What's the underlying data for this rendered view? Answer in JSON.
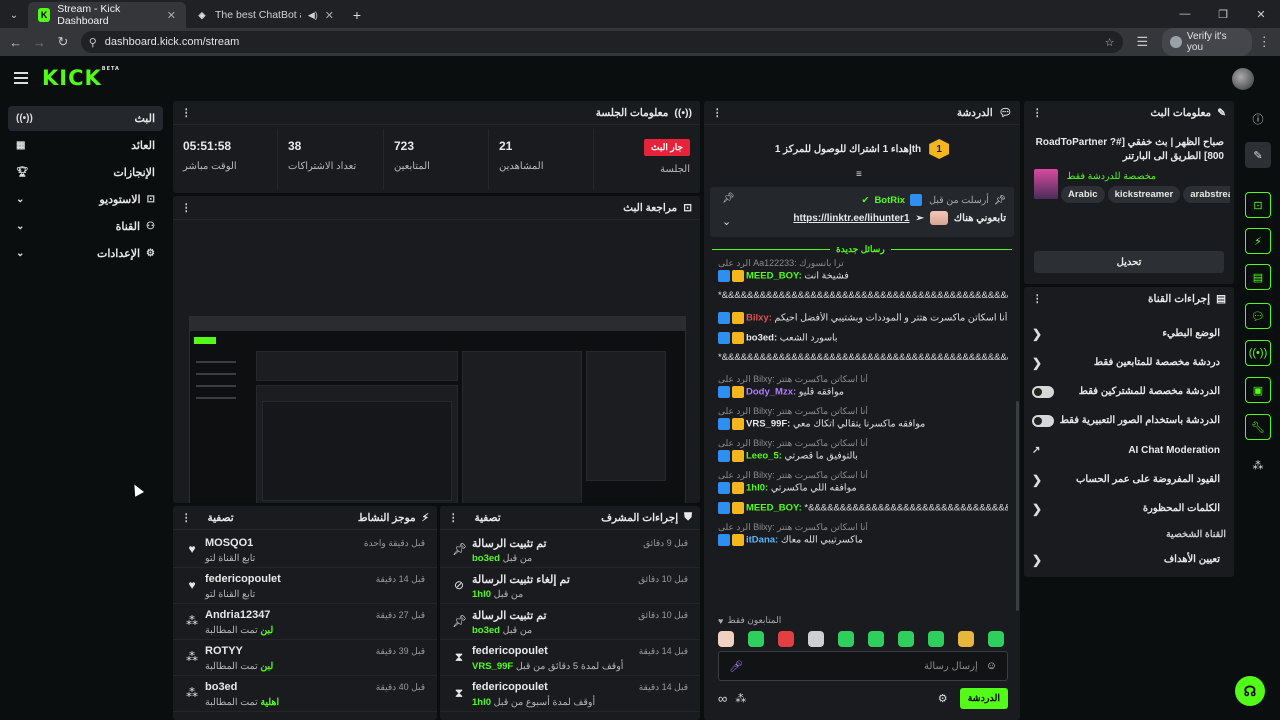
{
  "browser": {
    "tabs": [
      {
        "title": "Stream - Kick Dashboard",
        "active": true
      },
      {
        "title": "The best ChatBot and Widg",
        "active": false
      }
    ],
    "url": "dashboard.kick.com/stream",
    "profile_label": "Verify it's you"
  },
  "brand": {
    "logo": "KICK",
    "beta": "BETA",
    "accent": "#53fc18"
  },
  "sidebar": {
    "items": [
      {
        "label": "البث",
        "icon": "broadcast-icon"
      },
      {
        "label": "العائد",
        "icon": "revenue-icon"
      },
      {
        "label": "الإنجازات",
        "icon": "trophy-icon"
      },
      {
        "label": "الاستوديو",
        "icon": "studio-icon"
      },
      {
        "label": "القناة",
        "icon": "channel-icon"
      },
      {
        "label": "الإعدادات",
        "icon": "gear-icon"
      }
    ]
  },
  "session": {
    "title": "معلومات الجلسة",
    "stats": [
      {
        "value": "05:51:58",
        "label": "الوقت مباشر"
      },
      {
        "value": "38",
        "label": "تعداد الاشتراكات"
      },
      {
        "value": "723",
        "label": "المتابعين"
      },
      {
        "value": "21",
        "label": "المشاهدين"
      },
      {
        "badge": "جار البث",
        "label": "الجلسة"
      }
    ]
  },
  "preview": {
    "title": "مراجعة البث"
  },
  "activity": {
    "title": "موجز النشاط",
    "filter": "تصفية",
    "rows": [
      {
        "name": "MOSQO1",
        "sub": "تابع القناة لتو",
        "time": "قبل دقيقة واحدة",
        "icon": "heart-icon"
      },
      {
        "name": "federicopoulet",
        "sub": "تابع القناة لتو",
        "time": "قبل 14 دقيقة",
        "icon": "heart-icon"
      },
      {
        "name": "Andria12347",
        "sub": "تمت المطالبة",
        "subHighlight": "لبن",
        "time": "قبل 27 دقيقة",
        "icon": "claim-icon"
      },
      {
        "name": "ROTYY",
        "sub": "تمت المطالبة",
        "subHighlight": "لبن",
        "time": "قبل 39 دقيقة",
        "icon": "claim-icon"
      },
      {
        "name": "bo3ed",
        "sub": "تمت المطالبة",
        "subHighlight": "اهلية",
        "time": "قبل 40 دقيقة",
        "icon": "claim-icon"
      }
    ]
  },
  "modactions": {
    "title": "إجراءات المشرف",
    "filter": "تصفية",
    "rows": [
      {
        "name": "تم تثبيت الرسالة",
        "sub": "من قبل",
        "subUser": "bo3ed",
        "time": "قبل 9 دقائق",
        "icon": "pin-icon"
      },
      {
        "name": "تم إلغاء تثبيت الرسالة",
        "sub": "من قبل",
        "subUser": "1hl0",
        "time": "قبل 10 دقائق",
        "icon": "unpin-icon"
      },
      {
        "name": "تم تثبيت الرسالة",
        "sub": "من قبل",
        "subUser": "bo3ed",
        "time": "قبل 10 دقائق",
        "icon": "pin-icon"
      },
      {
        "name": "federicopoulet",
        "sub": "أوقف لمدة 5 دقائق من قبل",
        "subUser": "VRS_99F",
        "time": "قبل 14 دقيقة",
        "icon": "hourglass-icon"
      },
      {
        "name": "federicopoulet",
        "sub": "أوقف لمدة أسبوع من قبل",
        "subUser": "1hl0",
        "time": "قبل 14 دقيقة",
        "icon": "hourglass-icon"
      }
    ]
  },
  "chat": {
    "title": "الدردشة",
    "goal": "إهداء 1 اشتراك للوصول للمركز 1th",
    "goal_rank": "1",
    "pinned_by": "أرسلت من قبل",
    "pinned_user": "BotRix",
    "pinned_text": "تابعوني هناك",
    "pinned_link": "https://linktr.ee/lihunter1",
    "new_messages": "رسائل جديدة",
    "messages": [
      {
        "reply": "الرد على Aa122233: ترا بانسورك",
        "user": "MEED_BOY:",
        "text": "فشيخة انت",
        "color": "#53fc18"
      },
      {
        "text": "*&&&&&&&&&&&&&&&&&&&&&&&&&&&&&&&&&&&&&&&&&&&&&&&&&&&&&&&&&&"
      },
      {
        "user": "Bilxy:",
        "text": "أنا اسكاتن ماكسرت هتتر و الموددات وبشتيبي الأفضل احيكم",
        "color": "#e05252"
      },
      {
        "user": "bo3ed:",
        "text": "باسورد الشعب",
        "color": "#e8e8e8"
      },
      {
        "text": "*&&&&&&&&&&&&&&&&&&&&&&&&&&&&&&&&&&&&&&&&&&&&&&&&&&&&&&&&&&"
      },
      {
        "reply": "الرد على Bilxy: أنا اسكاتن ماكسرت هتتر",
        "user": "Dody_Mzx:",
        "text": "موافقه قليو",
        "color": "#b07bff"
      },
      {
        "reply": "الرد على Bilxy: أنا اسكاتن ماكسرت هتتر",
        "user": "VRS_99F:",
        "text": "موافقه ماكسرنا يتقالي اتكاك معي",
        "color": "#e8e8e8"
      },
      {
        "reply": "الرد على Bilxy: أنا اسكاتن ماكسرت هتتر",
        "user": "Leeo_5:",
        "text": "بالتوفيق ما قصرتي",
        "color": "#53fc18"
      },
      {
        "reply": "الرد على Bilxy: أنا اسكاتن ماكسرت هتتر",
        "user": "1hl0:",
        "text": "موافقه اللي ماكسرتي",
        "color": "#53fc18"
      },
      {
        "user": "MEED_BOY:",
        "text": "*&&&&&&&&&&&&&&&&&&&&&&&&&&&&&&&&&&&&&&&&&&&&&&&",
        "color": "#53fc18"
      },
      {
        "reply": "الرد على Bilxy: أنا اسكاتن ماكسرت هتتر",
        "user": "itDana:",
        "text": "ماكسرتيبي الله معاك",
        "color": "#5ab8ff"
      }
    ],
    "followers_only": "المتابعون فقط",
    "input_placeholder": "إرسال رسالة",
    "send_label": "الدردشة"
  },
  "streaminfo": {
    "title": "معلومات البث",
    "stream_title": "صباح الظهر | بث خفقي [#RoadToPartner ?800] الطريق الى البارتنر",
    "category": "مخصصة للدردشة فقط",
    "tags": [
      "Arabic",
      "kickstreamer",
      "arabstreame"
    ],
    "edit_label": "تحديل"
  },
  "channelactions": {
    "title": "إجراءات القناة",
    "items": [
      {
        "label": "الوضع البطيء",
        "control": "chevron"
      },
      {
        "label": "دردشة مخصصة للمتابعين فقط",
        "control": "chevron"
      },
      {
        "label": "الدردشة مخصصة للمشتركين فقط",
        "control": "toggle"
      },
      {
        "label": "الدردشة باستخدام الصور التعبيرية فقط",
        "control": "toggle"
      },
      {
        "label": "AI Chat Moderation",
        "control": "external"
      },
      {
        "label": "القيود المفروضة على عمر الحساب",
        "control": "chevron"
      },
      {
        "label": "الكلمات المحظورة",
        "control": "chevron"
      }
    ],
    "section_label": "القناة الشخصية",
    "goals_label": "تعيين الأهداف"
  }
}
